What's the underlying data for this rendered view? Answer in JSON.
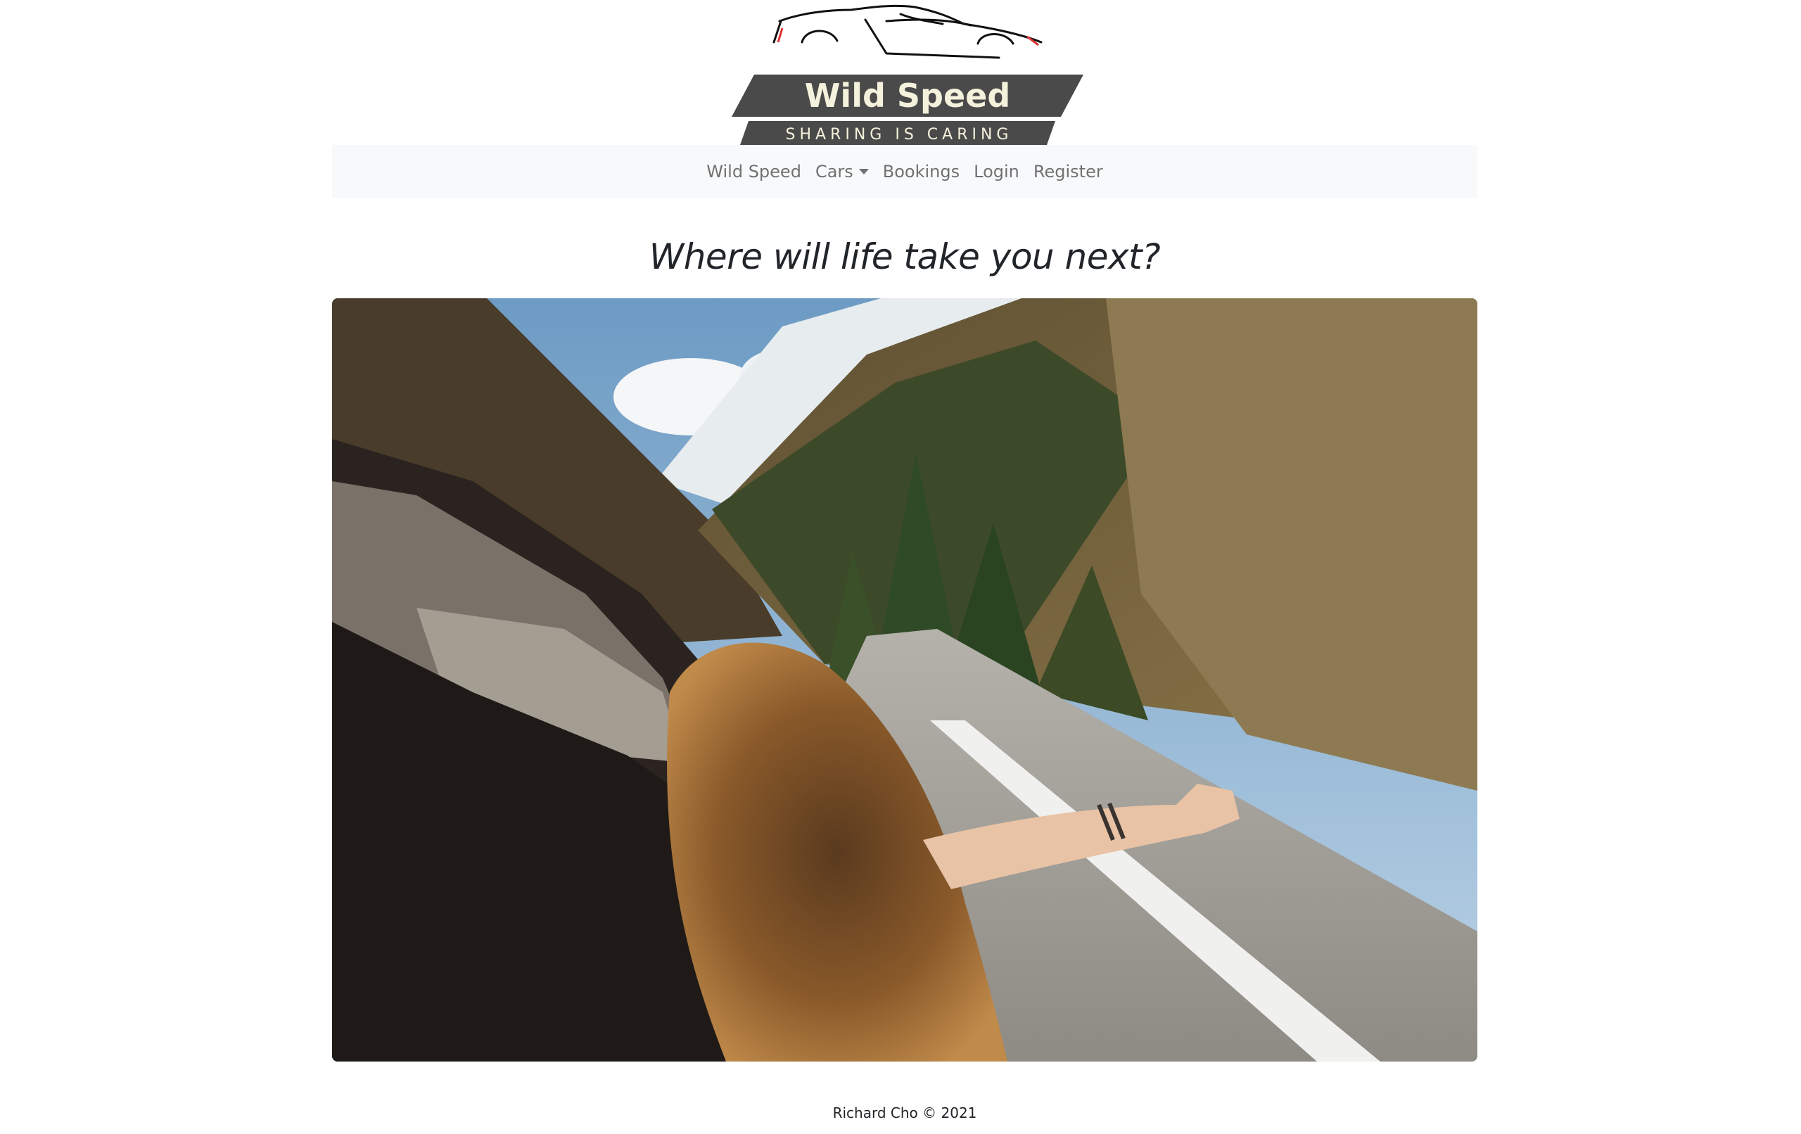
{
  "brand": {
    "name": "Wild Speed",
    "tagline": "SHARING IS CARING"
  },
  "nav": {
    "items": [
      {
        "label": "Wild Speed"
      },
      {
        "label": "Cars",
        "dropdown": true
      },
      {
        "label": "Bookings"
      },
      {
        "label": "Login"
      },
      {
        "label": "Register"
      }
    ]
  },
  "main": {
    "headline": "Where will life take you next?"
  },
  "footer": {
    "text": "Richard Cho © 2021"
  },
  "colors": {
    "nav_bg": "#f8f9fa",
    "logo_banner": "#4a4a4a",
    "logo_text": "#f4f1dc",
    "body_text": "#212529"
  }
}
